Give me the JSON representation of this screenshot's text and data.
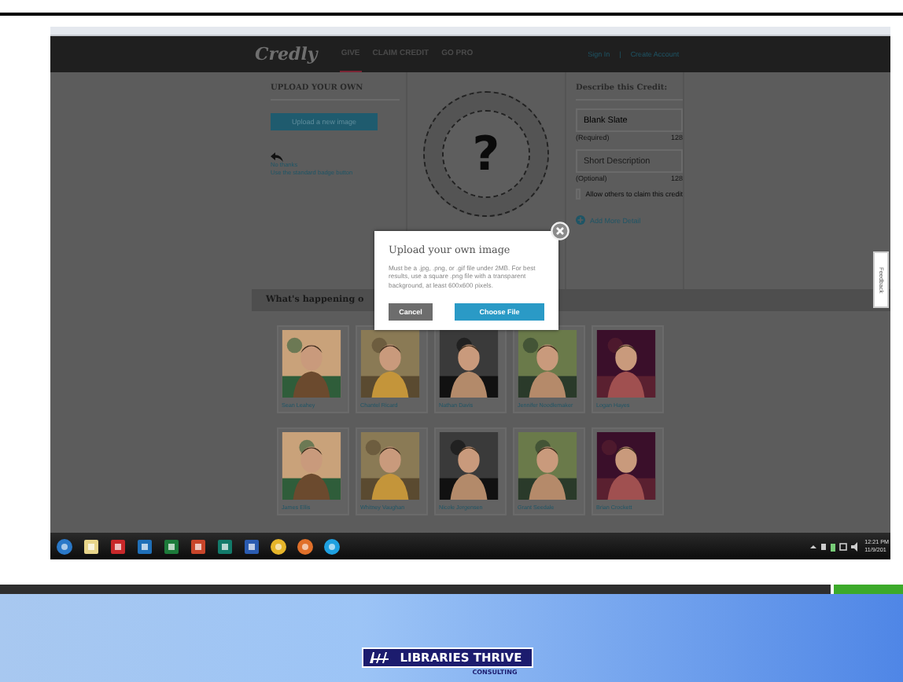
{
  "nav": {
    "logo": "Credly",
    "items": [
      {
        "label": "GIVE",
        "selected": true
      },
      {
        "label": "CLAIM CREDIT",
        "selected": false
      },
      {
        "label": "GO PRO",
        "selected": false
      }
    ],
    "sign_in": "Sign In",
    "separator": "|",
    "create_account": "Create Account"
  },
  "upload": {
    "title": "UPLOAD YOUR OWN",
    "button": "Upload a new image",
    "no_thanks": "No thanks",
    "standard": "Use the standard badge button"
  },
  "badge": {
    "symbol": "?"
  },
  "describe": {
    "title": "Describe this Credit:",
    "fields": [
      {
        "value": "Blank Slate",
        "note": "(Required)",
        "count": "128"
      },
      {
        "placeholder": "Short Description",
        "note": "(Optional)",
        "count": "128"
      }
    ],
    "allow": {
      "label": "Allow others to claim this credit",
      "checked": false
    },
    "add_more": "Add More Detail"
  },
  "feedback": "Feedback",
  "happening": {
    "title": "What's happening o",
    "people": [
      {
        "name": "Sean Leahey"
      },
      {
        "name": "Chantel Ricard"
      },
      {
        "name": "Nathan Davis"
      },
      {
        "name": "Jennifer Noodlemaker"
      },
      {
        "name": "Logan Hayes"
      },
      {
        "name": "James Ellis"
      },
      {
        "name": "Whitney Vaughan"
      },
      {
        "name": "Nicole Jorgensen"
      },
      {
        "name": "Grant Seedale"
      },
      {
        "name": "Brian Crockett"
      }
    ]
  },
  "dialog": {
    "title": "Upload your own image",
    "text": "Must be a .jpg, .png, or .gif file under 2MB. For best results, use a square .png file with a transparent background, at least 600x600 pixels.",
    "buttons": [
      {
        "label": "Cancel",
        "kind": "secondary"
      },
      {
        "label": "Choose File",
        "kind": "primary"
      }
    ]
  },
  "taskbar": {
    "time": "12:21 PM",
    "date": "11/9/201"
  },
  "footer": {
    "logo": "LIBRARIES THRIVE",
    "tagline": "CONSULTING"
  }
}
